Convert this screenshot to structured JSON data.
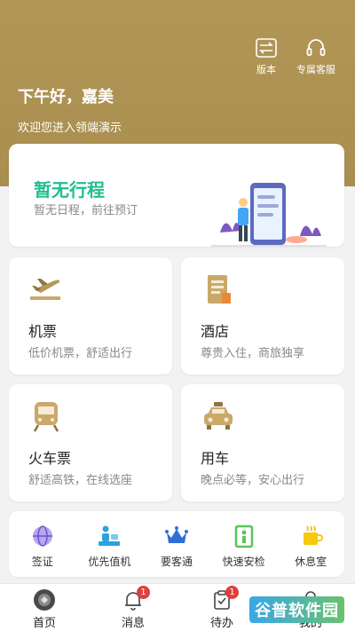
{
  "header": {
    "version_label": "版本",
    "service_label": "专属客服",
    "greeting": "下午好，嘉美",
    "welcome": "欢迎您进入领端演示"
  },
  "trip": {
    "title": "暂无行程",
    "subtitle": "暂无日程，前往预订"
  },
  "services": [
    {
      "title": "机票",
      "subtitle": "低价机票，舒适出行",
      "icon": "plane-icon"
    },
    {
      "title": "酒店",
      "subtitle": "尊贵入住，商旅独享",
      "icon": "hotel-icon"
    },
    {
      "title": "火车票",
      "subtitle": "舒适高铁，在线选座",
      "icon": "train-icon"
    },
    {
      "title": "用车",
      "subtitle": "晚点必等，安心出行",
      "icon": "taxi-icon"
    }
  ],
  "quick": [
    {
      "label": "签证",
      "icon": "globe-icon"
    },
    {
      "label": "优先值机",
      "icon": "checkin-icon"
    },
    {
      "label": "要客通",
      "icon": "crown-icon"
    },
    {
      "label": "快速安检",
      "icon": "security-gate-icon"
    },
    {
      "label": "休息室",
      "icon": "cup-icon"
    }
  ],
  "tabs": [
    {
      "label": "首页",
      "icon": "home-icon",
      "badge": ""
    },
    {
      "label": "消息",
      "icon": "bell-icon",
      "badge": "1"
    },
    {
      "label": "待办",
      "icon": "clipboard-icon",
      "badge": "1"
    },
    {
      "label": "我的",
      "icon": "user-icon",
      "badge": ""
    }
  ],
  "watermark": "谷普软件园",
  "colors": {
    "brand": "#ad9252",
    "accent_green": "#1fbf8f",
    "badge": "#e23d3d"
  }
}
